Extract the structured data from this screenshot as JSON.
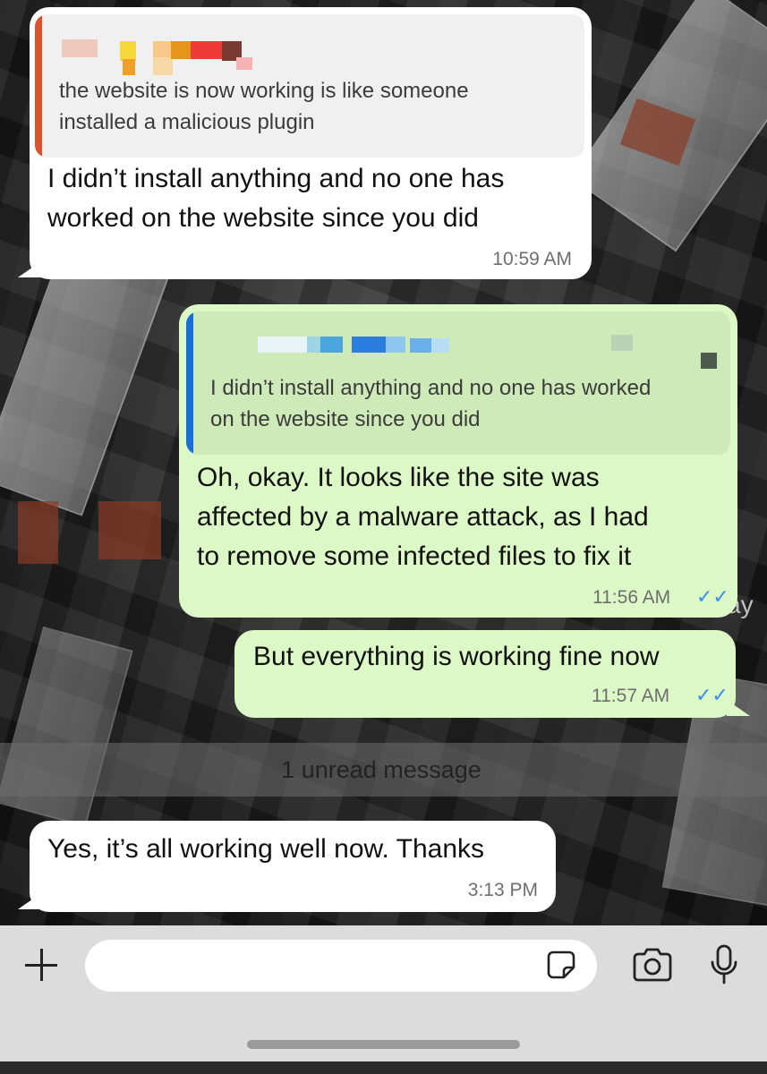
{
  "messages": [
    {
      "direction": "incoming",
      "reply_to": {
        "lines": [
          "the website is now working is like someone",
          "installed a malicious plugin"
        ]
      },
      "lines": [
        "I didn’t install anything and no one has",
        "worked on the website since you did"
      ],
      "time": "10:59 AM"
    },
    {
      "direction": "outgoing",
      "reply_to": {
        "lines": [
          "I didn’t install anything and no one has worked",
          "on the website since you did"
        ]
      },
      "lines": [
        "Oh, okay. It looks like the site was",
        "affected by a malware attack, as I had",
        "to remove some infected files to fix it"
      ],
      "time": "11:56 AM",
      "status": "✓✓"
    },
    {
      "direction": "outgoing",
      "lines": [
        "But everything is working fine now"
      ],
      "time": "11:57 AM",
      "status": "✓✓"
    },
    {
      "direction": "incoming",
      "lines": [
        "Yes, it’s all working well now. Thanks"
      ],
      "time": "3:13 PM"
    }
  ],
  "unread_banner": "1 unread message",
  "wallpaper_fragment": "ay",
  "composer": {
    "placeholder": ""
  },
  "icons": {
    "attach": "plus-icon",
    "sticker": "sticker-icon",
    "camera": "camera-icon",
    "mic": "microphone-icon",
    "read_receipt": "double-check-icon"
  },
  "colors": {
    "incoming_bubble": "#ffffff",
    "outgoing_bubble": "#dcf8c6",
    "incoming_quote_bar": "#d9532b",
    "outgoing_quote_bar": "#1a6fd6",
    "read_ticks": "#3b8de8"
  }
}
